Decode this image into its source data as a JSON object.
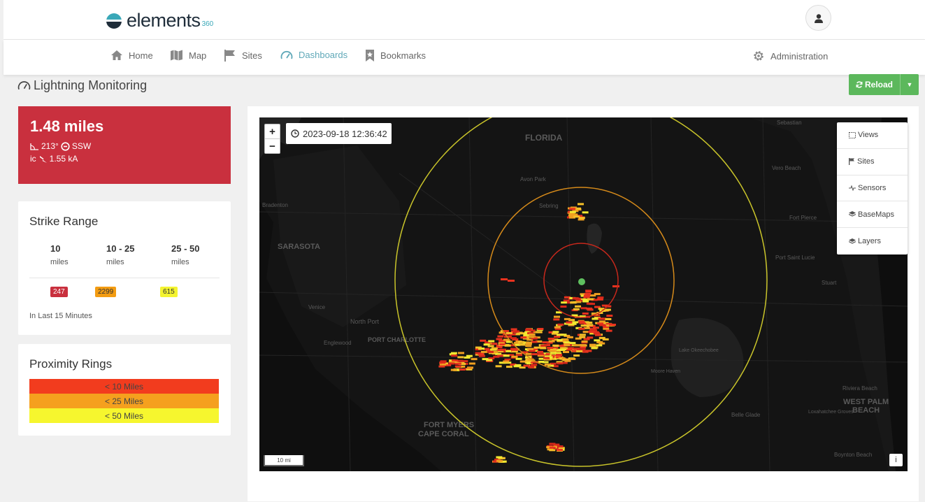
{
  "brand": {
    "name": "elements",
    "suffix": "360"
  },
  "nav": {
    "items": [
      {
        "label": "Home",
        "icon": "home-icon"
      },
      {
        "label": "Map",
        "icon": "map-icon"
      },
      {
        "label": "Sites",
        "icon": "flag-icon"
      },
      {
        "label": "Dashboards",
        "icon": "gauge-icon",
        "active": true
      },
      {
        "label": "Bookmarks",
        "icon": "bookmark-icon"
      },
      {
        "label": "Administration",
        "icon": "gear-icon"
      }
    ]
  },
  "page": {
    "title": "Lightning Monitoring"
  },
  "reload": {
    "label": "Reload"
  },
  "latest_strike": {
    "distance": "1.48 miles",
    "bearing": "213°",
    "direction": "SSW",
    "type": "ic",
    "current": "1.55 kA"
  },
  "strike_range": {
    "title": "Strike Range",
    "columns": [
      {
        "value": "10",
        "unit": "miles",
        "count": "247",
        "color": "#c9303e",
        "text_color": "#ffffff"
      },
      {
        "value": "10 - 25",
        "unit": "miles",
        "count": "2299",
        "color": "#f39c12",
        "text_color": "#333333"
      },
      {
        "value": "25 - 50",
        "unit": "miles",
        "count": "615",
        "color": "#f4f430",
        "text_color": "#333333"
      }
    ],
    "note": "In Last 15 Minutes"
  },
  "proximity_rings": {
    "title": "Proximity Rings",
    "rings": [
      {
        "label": "< 10 Miles",
        "color": "#f23c1e"
      },
      {
        "label": "< 25 Miles",
        "color": "#f5a01e"
      },
      {
        "label": "< 50 Miles",
        "color": "#f6f62e"
      }
    ]
  },
  "map": {
    "timestamp": "2023-09-18 12:36:42",
    "zoom_in": "+",
    "zoom_out": "−",
    "scale": "10 mi",
    "info": "i",
    "panel": [
      {
        "label": "Views",
        "icon": "views-icon"
      },
      {
        "label": "Sites",
        "icon": "flag-icon"
      },
      {
        "label": "Sensors",
        "icon": "sensor-icon"
      },
      {
        "label": "BaseMaps",
        "icon": "layers-icon"
      },
      {
        "label": "Layers",
        "icon": "layers-icon"
      }
    ],
    "places": [
      "FLORIDA",
      "Sebastian",
      "Avon Park",
      "Vero Beach",
      "Sebring",
      "Bradenton",
      "Fort Pierce",
      "SARASOTA",
      "Port Saint Lucie",
      "Stuart",
      "Venice",
      "North Port",
      "PORT CHARLOTTE",
      "Englewood",
      "Lake Okeechobee",
      "Riviera Beach",
      "WEST PALM",
      "BEACH",
      "Loxahatchee Groves",
      "FORT MYERS",
      "CAPE CORAL",
      "Moore Haven",
      "Belle Glade",
      "Boynton Beach"
    ]
  }
}
